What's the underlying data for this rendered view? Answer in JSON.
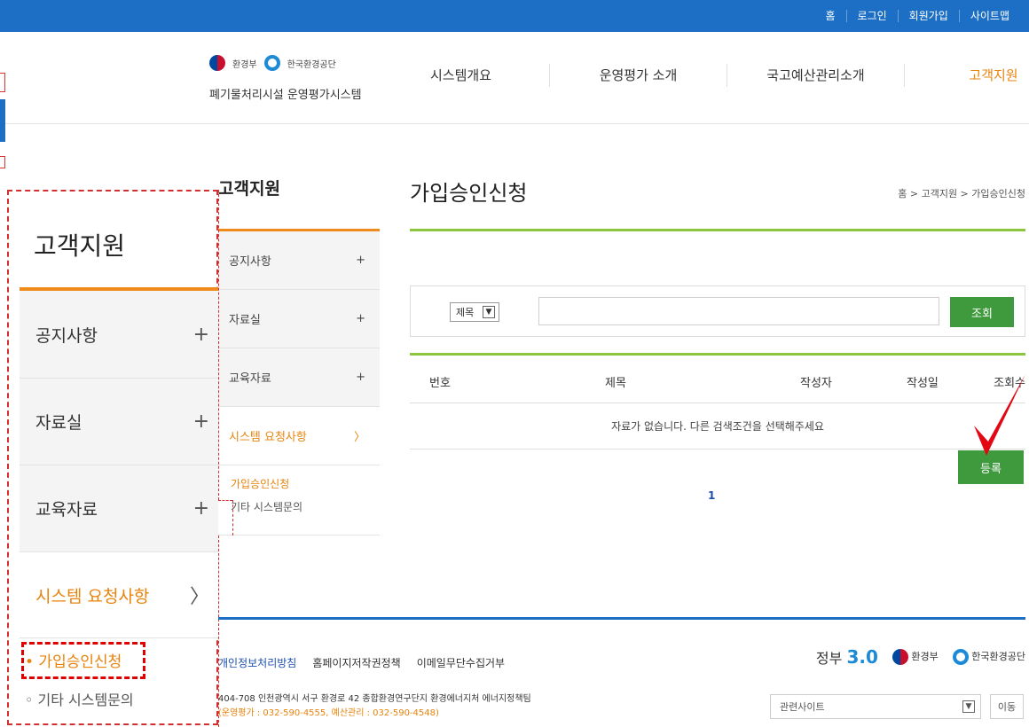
{
  "topbar": {
    "links": [
      "홈",
      "로그인",
      "회원가입",
      "사이트맵"
    ]
  },
  "header": {
    "logo1": "환경부",
    "logo2": "한국환경공단",
    "site_title": "폐기물처리시설 운영평가시스템",
    "gnb": [
      "시스템개요",
      "운영평가 소개",
      "국고예산관리소개",
      "고객지원"
    ]
  },
  "sidebar": {
    "title": "고객지원",
    "items": [
      {
        "label": "공지사항",
        "symbol": "+"
      },
      {
        "label": "자료실",
        "symbol": "+"
      },
      {
        "label": "교육자료",
        "symbol": "+"
      },
      {
        "label": "시스템 요청사항",
        "symbol": "〉"
      }
    ],
    "sub_items": [
      "가입승인신청",
      "기타 시스템문의"
    ]
  },
  "zoom": {
    "title": "고객지원",
    "items": [
      {
        "label": "공지사항",
        "symbol": "+"
      },
      {
        "label": "자료실",
        "symbol": "+"
      },
      {
        "label": "교육자료",
        "symbol": "+"
      },
      {
        "label": "시스템 요청사항",
        "symbol": "〉"
      }
    ],
    "sub_items": [
      "• 가입승인신청",
      "◦ 기타 시스템문의"
    ]
  },
  "main": {
    "page_title": "가입승인신청",
    "breadcrumb": "홈 > 고객지원 > 가입승인신청"
  },
  "search": {
    "select_value": "제목",
    "input_value": "",
    "button_label": "조회"
  },
  "table": {
    "columns": [
      "번호",
      "제목",
      "작성자",
      "작성일",
      "조회수"
    ],
    "empty_message": "자료가 없습니다. 다른 검색조건을 선택해주세요"
  },
  "register_label": "등록",
  "pagination": "1",
  "footer": {
    "links": [
      "개인정보처리방침",
      "홈페이지저작권정책",
      "이메일무단수집거부"
    ],
    "address": "404-708 인천광역시 서구 환경로 42 종합환경연구단지 환경에너지처 에너지정책팀",
    "phones": "(운영평가 : 032-590-4555, 예산관리 : 032-590-4548)",
    "logo_gov": "정부",
    "logo_gov_num": "3.0",
    "logo_me": "환경부",
    "logo_keco": "한국환경공단",
    "related_sites": "관련사이트",
    "move_label": "이동"
  }
}
